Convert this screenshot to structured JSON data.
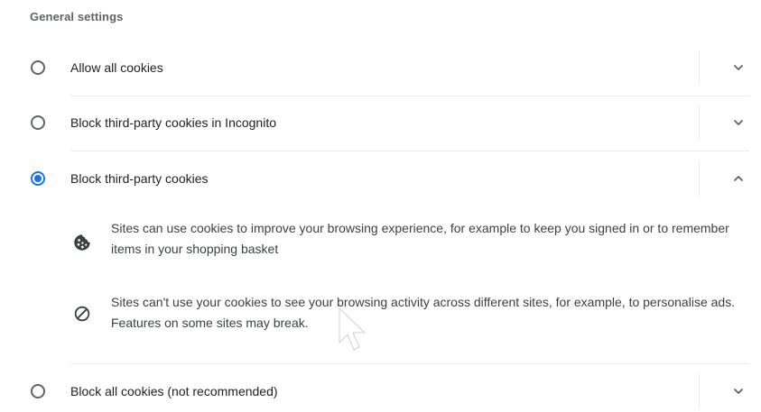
{
  "section": {
    "title": "General settings"
  },
  "options": [
    {
      "label": "Allow all cookies",
      "selected": false,
      "expanded": false
    },
    {
      "label": "Block third-party cookies in Incognito",
      "selected": false,
      "expanded": false
    },
    {
      "label": "Block third-party cookies",
      "selected": true,
      "expanded": true
    },
    {
      "label": "Block all cookies (not recommended)",
      "selected": false,
      "expanded": false
    }
  ],
  "details": [
    {
      "icon": "cookie-icon",
      "text": "Sites can use cookies to improve your browsing experience, for example to keep you signed in or to remember items in your shopping basket"
    },
    {
      "icon": "block-icon",
      "text": "Sites can't use your cookies to see your browsing activity across different sites, for example, to personalise ads. Features on some sites may break."
    }
  ],
  "colors": {
    "accent": "#1a73e8",
    "radio_border": "#5f6368",
    "divider": "#e8eaed",
    "text_primary": "#202124",
    "text_secondary": "#3c4043",
    "section_title": "#5f6368"
  }
}
